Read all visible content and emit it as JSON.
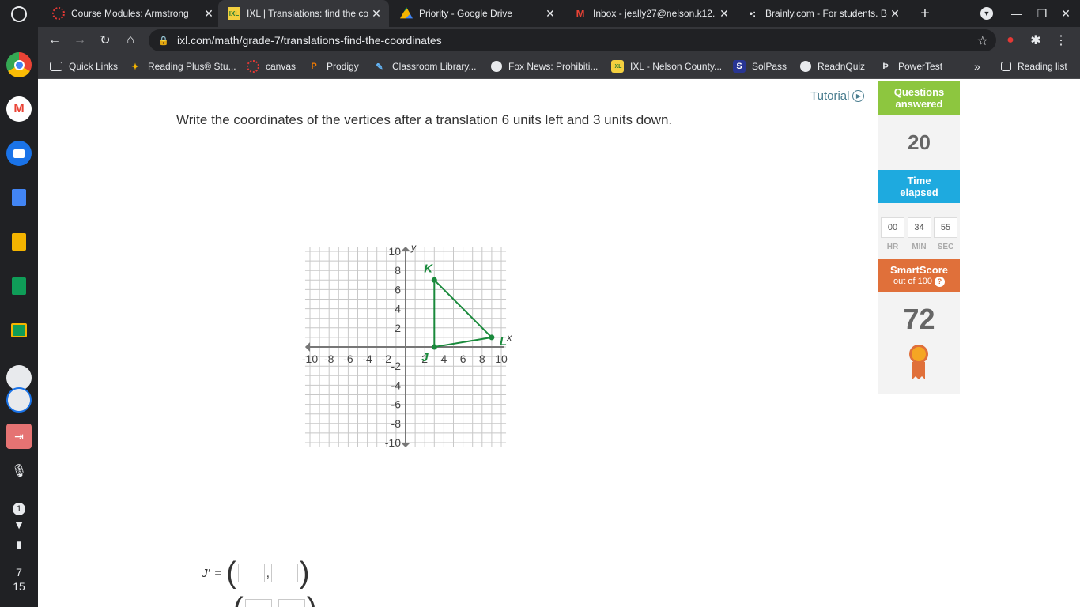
{
  "shelf": {
    "status_notifications": "1",
    "date_month": "7",
    "date_day": "15"
  },
  "tabs": [
    {
      "title": "Course Modules: Armstrong",
      "icon": "canvas-icon",
      "active": false
    },
    {
      "title": "IXL | Translations: find the co",
      "icon": "ixl-icon",
      "active": true
    },
    {
      "title": "Priority - Google Drive",
      "icon": "google-drive-icon",
      "active": false
    },
    {
      "title": "Inbox - jeally27@nelson.k12.",
      "icon": "gmail-icon",
      "active": false
    },
    {
      "title": "Brainly.com - For students. B",
      "icon": "brainly-icon",
      "active": false
    }
  ],
  "toolbar": {
    "url": "ixl.com/math/grade-7/translations-find-the-coordinates"
  },
  "bookmarks": [
    {
      "label": "Quick Links"
    },
    {
      "label": "Reading Plus® Stu..."
    },
    {
      "label": "canvas"
    },
    {
      "label": "Prodigy"
    },
    {
      "label": "Classroom Library..."
    },
    {
      "label": "Fox News: Prohibiti..."
    },
    {
      "label": "IXL - Nelson County..."
    },
    {
      "label": "SolPass"
    },
    {
      "label": "ReadnQuiz"
    },
    {
      "label": "PowerTest"
    }
  ],
  "reading_list": "Reading list",
  "question": {
    "text": "Write the coordinates of the vertices after a translation 6 units left and 3 units down.",
    "tutorial": "Tutorial"
  },
  "graph": {
    "x_axis_label": "x",
    "y_axis_label": "y",
    "x_ticks": [
      "-10",
      "-8",
      "-6",
      "-4",
      "-2",
      "2",
      "4",
      "6",
      "8",
      "10"
    ],
    "y_ticks": [
      "10",
      "8",
      "6",
      "4",
      "2",
      "-2",
      "-4",
      "-6",
      "-8",
      "-10"
    ],
    "vertices": [
      {
        "name": "K",
        "x": 3,
        "y": 7
      },
      {
        "name": "L",
        "x": 9,
        "y": 1
      },
      {
        "name": "J",
        "x": 3,
        "y": 0
      }
    ],
    "color": "#1a8a3c"
  },
  "answers": [
    {
      "label": "J′",
      "equals": "="
    }
  ],
  "sidebar": {
    "questions_answered_label_1": "Questions",
    "questions_answered_label_2": "answered",
    "questions_answered": "20",
    "time_elapsed_label_1": "Time",
    "time_elapsed_label_2": "elapsed",
    "time_hr": "00",
    "time_min": "34",
    "time_sec": "55",
    "hr_label": "HR",
    "min_label": "MIN",
    "sec_label": "SEC",
    "smartscore_label": "SmartScore",
    "smartscore_sub": "out of 100",
    "smartscore": "72",
    "colors": {
      "questions": "#8dc63f",
      "time": "#1eaadf",
      "smartscore": "#e0703a"
    }
  }
}
